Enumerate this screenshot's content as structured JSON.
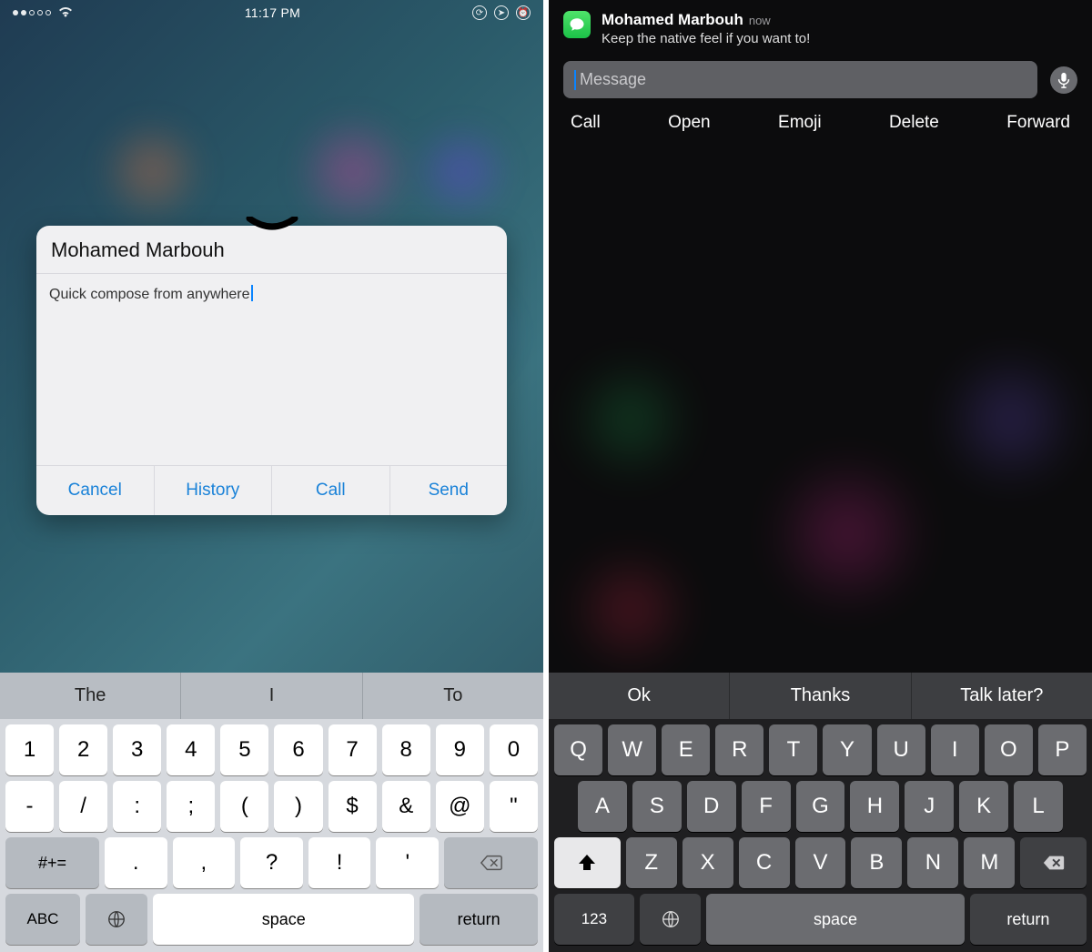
{
  "left": {
    "statusbar": {
      "time": "11:17 PM"
    },
    "compose": {
      "contact": "Mohamed Marbouh",
      "text": "Quick compose from anywhere",
      "actions": {
        "cancel": "Cancel",
        "history": "History",
        "call": "Call",
        "send": "Send"
      }
    },
    "keyboard": {
      "suggestions": [
        "The",
        "I",
        "To"
      ],
      "row1": [
        "1",
        "2",
        "3",
        "4",
        "5",
        "6",
        "7",
        "8",
        "9",
        "0"
      ],
      "row2": [
        "-",
        "/",
        ":",
        ";",
        "(",
        ")",
        "$",
        "&",
        "@",
        "\""
      ],
      "row3": {
        "sym": "#+=",
        "keys": [
          ".",
          ",",
          "?",
          "!",
          "'"
        ]
      },
      "row4": {
        "abc": "ABC",
        "space": "space",
        "return": "return"
      }
    }
  },
  "right": {
    "notification": {
      "sender": "Mohamed Marbouh",
      "when": "now",
      "message": "Keep the native feel if you want to!"
    },
    "reply": {
      "placeholder": "Message"
    },
    "actions": [
      "Call",
      "Open",
      "Emoji",
      "Delete",
      "Forward"
    ],
    "keyboard": {
      "suggestions": [
        "Ok",
        "Thanks",
        "Talk later?"
      ],
      "row1": [
        "Q",
        "W",
        "E",
        "R",
        "T",
        "Y",
        "U",
        "I",
        "O",
        "P"
      ],
      "row2": [
        "A",
        "S",
        "D",
        "F",
        "G",
        "H",
        "J",
        "K",
        "L"
      ],
      "row3": [
        "Z",
        "X",
        "C",
        "V",
        "B",
        "N",
        "M"
      ],
      "row4": {
        "num": "123",
        "space": "space",
        "return": "return"
      }
    }
  }
}
